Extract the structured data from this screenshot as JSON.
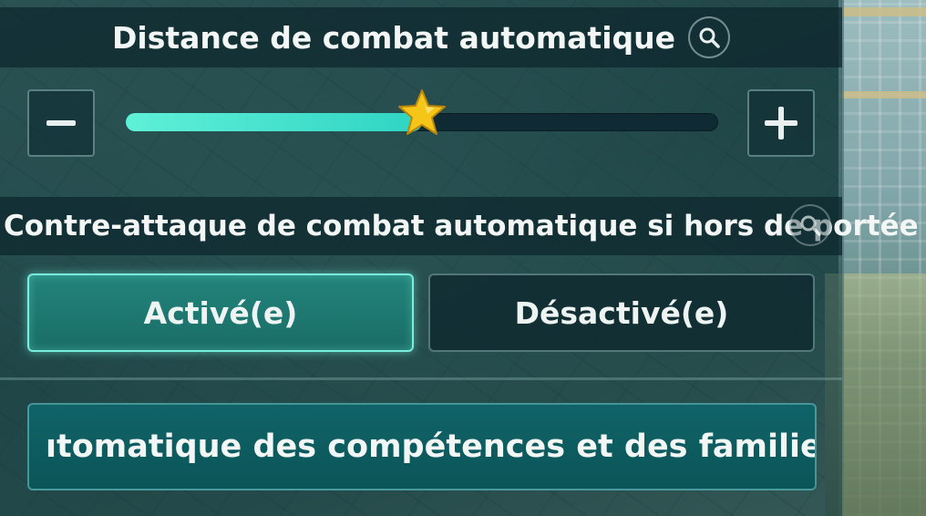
{
  "auto_combat_distance": {
    "title": "Distance de combat automatique",
    "slider_value_percent": 50,
    "decrease_label": "−",
    "increase_label": "+"
  },
  "counter_attack": {
    "title": "Contre-attaque de combat automatique si hors de portée",
    "option_on": "Activé(e)",
    "option_off": "Désactivé(e)",
    "selected": "Activé(e)"
  },
  "skills_button": {
    "label": "ıtomatique des compétences et des familie"
  },
  "colors": {
    "accent": "#5ff0d8",
    "panel": "#163e42",
    "star": "#f5c518"
  },
  "icons": {
    "info": "magnifier-icon",
    "slider_thumb": "star-icon"
  }
}
